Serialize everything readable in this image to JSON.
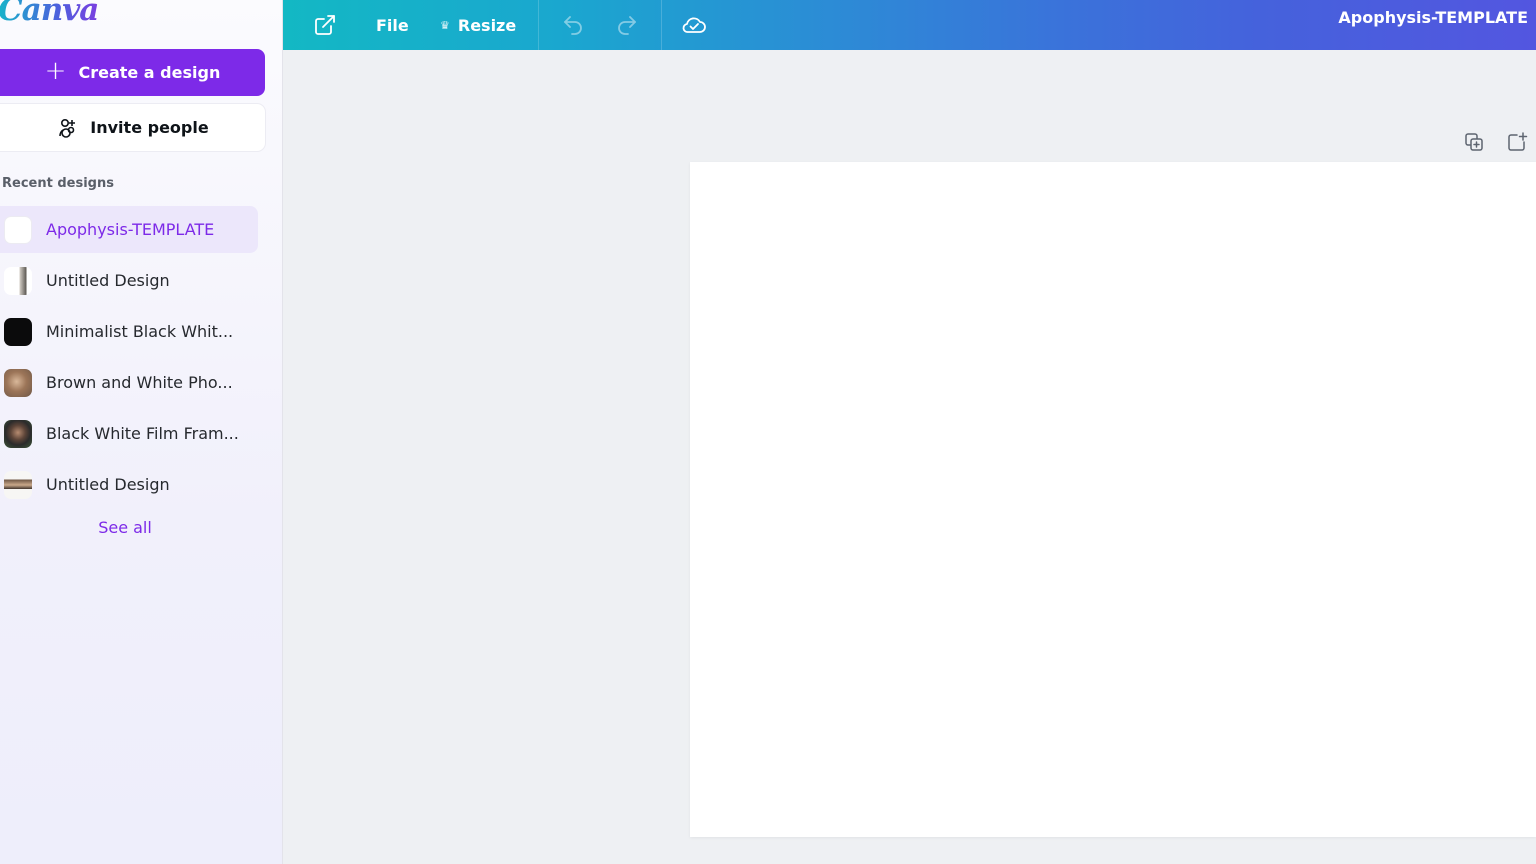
{
  "sidebar": {
    "logo": "Canva",
    "create_label": "Create a design",
    "invite_label": "Invite people",
    "recent_heading": "Recent designs",
    "recent": [
      {
        "label": "Apophysis-TEMPLATE",
        "active": true
      },
      {
        "label": "Untitled Design",
        "active": false
      },
      {
        "label": "Minimalist Black Whit...",
        "active": false
      },
      {
        "label": "Brown and White Pho...",
        "active": false
      },
      {
        "label": "Black White Film Fram...",
        "active": false
      },
      {
        "label": "Untitled Design",
        "active": false
      }
    ],
    "see_all": "See all"
  },
  "topbar": {
    "home_icon": "external-link-icon",
    "file_label": "File",
    "resize_label": "Resize",
    "undo_icon": "undo-icon",
    "redo_icon": "redo-icon",
    "save_icon": "cloud-check-icon",
    "doc_title": "Apophysis-TEMPLATE"
  },
  "colors": {
    "accent": "#7d2ae8",
    "topbar_start": "#13b8c4",
    "topbar_end": "#5356e0"
  }
}
